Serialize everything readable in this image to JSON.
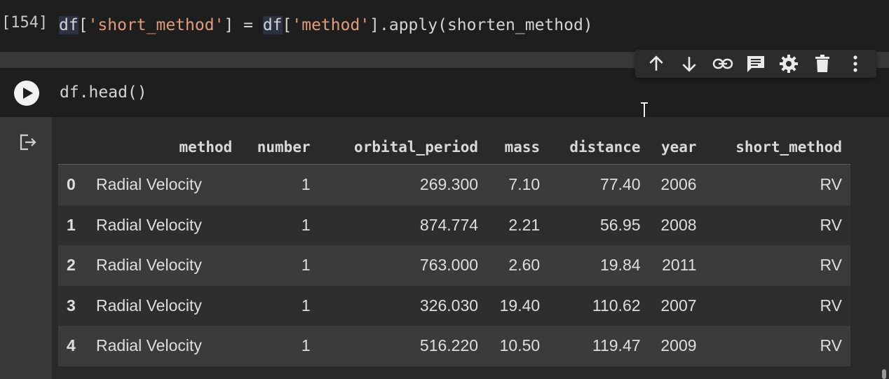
{
  "prev_cell": {
    "exec_count": "[154]",
    "code_tokens": [
      "df",
      "[",
      "'short_method'",
      "] = ",
      "df",
      "[",
      "'method'",
      "].apply(shorten_method)"
    ]
  },
  "active_cell": {
    "code": "df.head()"
  },
  "toolbar": {
    "icons": [
      "arrow-up-icon",
      "arrow-down-icon",
      "link-icon",
      "comment-icon",
      "gear-icon",
      "trash-icon",
      "more-vert-icon"
    ]
  },
  "dataframe": {
    "columns": [
      "",
      "method",
      "number",
      "orbital_period",
      "mass",
      "distance",
      "year",
      "short_method"
    ],
    "rows": [
      [
        "0",
        "Radial Velocity",
        "1",
        "269.300",
        "7.10",
        "77.40",
        "2006",
        "RV"
      ],
      [
        "1",
        "Radial Velocity",
        "1",
        "874.774",
        "2.21",
        "56.95",
        "2008",
        "RV"
      ],
      [
        "2",
        "Radial Velocity",
        "1",
        "763.000",
        "2.60",
        "19.84",
        "2011",
        "RV"
      ],
      [
        "3",
        "Radial Velocity",
        "1",
        "326.030",
        "19.40",
        "110.62",
        "2007",
        "RV"
      ],
      [
        "4",
        "Radial Velocity",
        "1",
        "516.220",
        "10.50",
        "119.47",
        "2009",
        "RV"
      ]
    ]
  },
  "colors": {
    "background": "#383838",
    "cell_bg": "#1e1e1e",
    "string": "#e39c7a",
    "row_even": "#3b3b3b",
    "row_odd": "#2e2e2e"
  }
}
